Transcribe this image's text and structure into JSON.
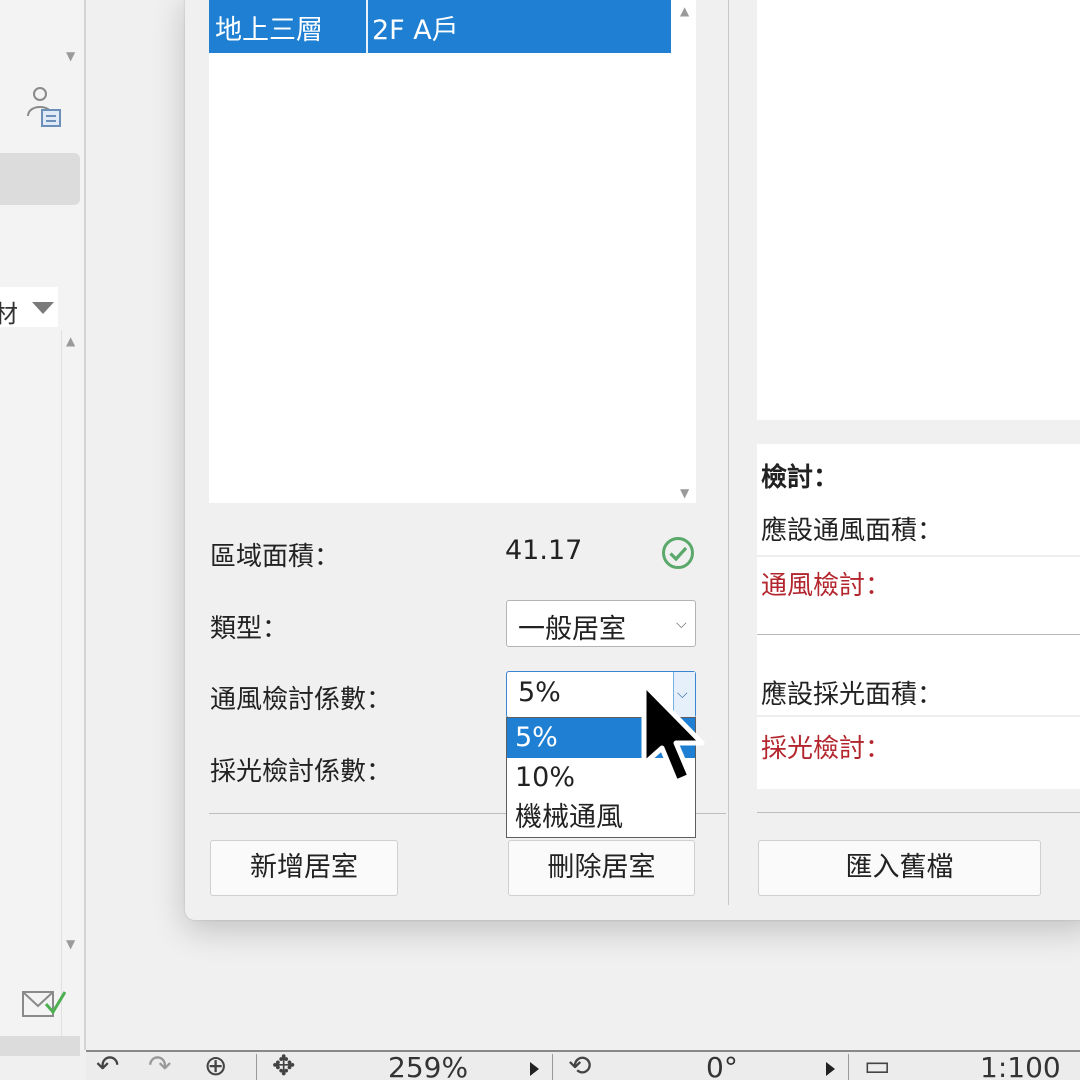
{
  "left_panel": {
    "dropdown_text": "材"
  },
  "room_list": {
    "selected_row": {
      "floor": "地上三層",
      "name": "2F A戶"
    }
  },
  "form": {
    "area_label": "區域面積：",
    "area_value": "41.17",
    "type_label": "類型：",
    "type_value": "一般居室",
    "vent_factor_label": "通風檢討係數：",
    "vent_factor_value": "5%",
    "vent_factor_options": [
      "5%",
      "10%",
      "機械通風"
    ],
    "light_factor_label": "採光檢討係數："
  },
  "buttons": {
    "add_room": "新增居室",
    "delete_room": "刪除居室",
    "import_old": "匯入舊檔"
  },
  "review": {
    "title": "檢討：",
    "required_vent_area": "應設通風面積：",
    "vent_check": "通風檢討：",
    "required_light_area": "應設採光面積：",
    "light_check": "採光檢討："
  },
  "statusbar": {
    "zoom": "259%",
    "angle": "0°",
    "scale": "1:100"
  },
  "colors": {
    "selection": "#1e7fd3",
    "warning_red": "#b3262e",
    "ok_green": "#5aa86a"
  }
}
